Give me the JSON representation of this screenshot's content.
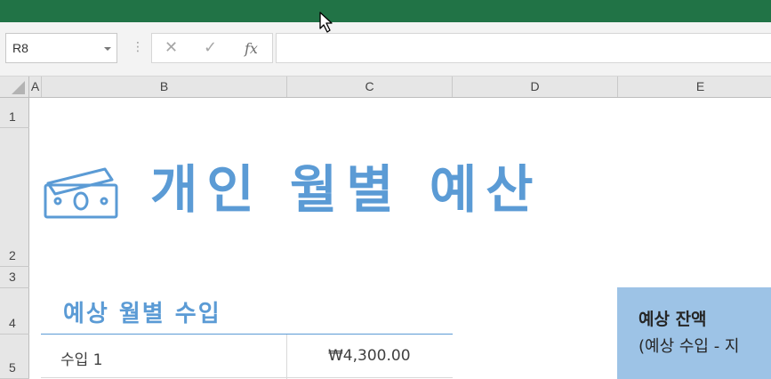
{
  "formula_bar": {
    "name_box": "R8",
    "separator": "⋮",
    "cancel_symbol": "✕",
    "enter_symbol": "✓",
    "function_symbol": "fx",
    "formula_value": ""
  },
  "columns": [
    "A",
    "B",
    "C",
    "D",
    "E"
  ],
  "rows": [
    "1",
    "2",
    "3",
    "4",
    "5"
  ],
  "sheet": {
    "title": "개인 월별 예산",
    "income_section_title": "예상 월별 수입",
    "income_rows": [
      {
        "label": "수입 1",
        "value": "₩4,300.00"
      }
    ],
    "balance_box": {
      "title": "예상 잔액",
      "subtitle": "(예상 수입 - 지"
    }
  },
  "colors": {
    "accent": "#5b9bd5",
    "title_bar": "#217346",
    "balance_fill": "#9dc3e6"
  },
  "icons": [
    "money-bill-icon",
    "cancel-icon",
    "enter-icon",
    "function-icon",
    "mouse-pointer-icon"
  ]
}
